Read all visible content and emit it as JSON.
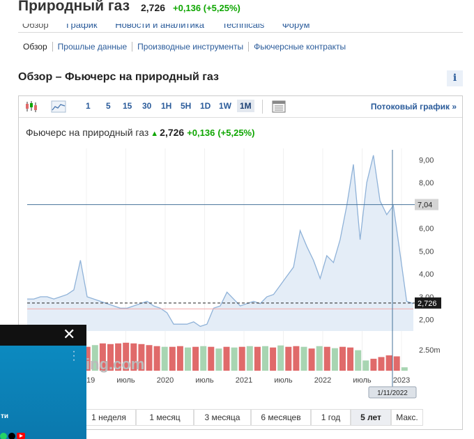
{
  "header": {
    "title": "Природный газ",
    "price": "2,726",
    "change": "+0,136 (+5,25%)"
  },
  "top_tabs": [
    "Обзор",
    "График",
    "Новости и аналитика",
    "Technicals",
    "Форум"
  ],
  "subnav": [
    "Обзор",
    "Прошлые данные",
    "Производные инструменты",
    "Фьючерсные контракты"
  ],
  "section_title": "Обзор – Фьючерс на природный газ",
  "info_icon_label": "i",
  "toolbar": {
    "periods": [
      "1",
      "5",
      "15",
      "30",
      "1H",
      "5H",
      "1D",
      "1W",
      "1M"
    ],
    "active_period": "1M",
    "stream_link": "Потоковый график »"
  },
  "chart_header": {
    "name": "Фьючерс на природный газ",
    "price": "2,726",
    "change": "+0,136",
    "change_pct": "(+5,25%)"
  },
  "watermark": "ing.com",
  "range_buttons": [
    "1 неделя",
    "1 месяц",
    "3 месяца",
    "6 месяцев",
    "1 год",
    "5 лет",
    "Макс."
  ],
  "active_range": "5 лет",
  "video_overlay": {
    "close_label": "✕",
    "caption_fragment": "ти"
  },
  "colors": {
    "positive": "#0ea600",
    "link": "#2a5b9a",
    "area_fill": "#e4edf7",
    "line": "#8fb2d8",
    "volume_up": "#a8d5b2",
    "volume_down": "#e06a6a"
  },
  "chart_data": {
    "type": "area",
    "title": "Фьючерс на природный газ",
    "x_ticks": [
      "2019",
      "июль",
      "2020",
      "июль",
      "2021",
      "июль",
      "2022",
      "июль",
      "2023"
    ],
    "y_ticks": [
      "2,00",
      "3,00",
      "4,00",
      "5,00",
      "6,00",
      "7,00",
      "8,00",
      "9,00"
    ],
    "ylim": [
      1.5,
      9.5
    ],
    "crosshair_value": "7,04",
    "crosshair_date": "1/11/2022",
    "last_value": "2,726",
    "volume_label": "2.50m",
    "series": [
      {
        "values": [
          2.9,
          2.9,
          3.0,
          3.0,
          2.9,
          3.0,
          3.1,
          3.3,
          4.6,
          3.0,
          2.9,
          2.8,
          2.7,
          2.6,
          2.5,
          2.5,
          2.6,
          2.7,
          2.8,
          2.6,
          2.5,
          2.3,
          1.8,
          1.8,
          1.8,
          1.9,
          1.7,
          1.8,
          2.5,
          2.6,
          3.2,
          2.9,
          2.6,
          2.7,
          2.8,
          2.7,
          3.0,
          3.1,
          3.5,
          3.9,
          4.3,
          5.9,
          5.2,
          4.6,
          3.8,
          4.8,
          4.5,
          5.5,
          7.0,
          8.8,
          5.5,
          8.0,
          9.2,
          7.2,
          6.6,
          7.0,
          4.9,
          2.8,
          2.7
        ]
      }
    ],
    "volume": [
      {
        "v": 0.3,
        "up": true
      },
      {
        "v": 0.35,
        "up": false
      },
      {
        "v": 0.4,
        "up": true
      },
      {
        "v": 0.45,
        "up": false
      },
      {
        "v": 0.5,
        "up": true
      },
      {
        "v": 0.55,
        "up": false
      },
      {
        "v": 0.6,
        "up": true
      },
      {
        "v": 0.7,
        "up": false
      },
      {
        "v": 0.75,
        "up": true
      },
      {
        "v": 0.8,
        "up": false
      },
      {
        "v": 0.78,
        "up": false
      },
      {
        "v": 0.8,
        "up": false
      },
      {
        "v": 0.82,
        "up": false
      },
      {
        "v": 0.8,
        "up": false
      },
      {
        "v": 0.78,
        "up": false
      },
      {
        "v": 0.75,
        "up": false
      },
      {
        "v": 0.72,
        "up": false
      },
      {
        "v": 0.7,
        "up": true
      },
      {
        "v": 0.7,
        "up": false
      },
      {
        "v": 0.72,
        "up": false
      },
      {
        "v": 0.68,
        "up": true
      },
      {
        "v": 0.7,
        "up": false
      },
      {
        "v": 0.72,
        "up": true
      },
      {
        "v": 0.7,
        "up": false
      },
      {
        "v": 0.65,
        "up": true
      },
      {
        "v": 0.7,
        "up": false
      },
      {
        "v": 0.68,
        "up": true
      },
      {
        "v": 0.7,
        "up": false
      },
      {
        "v": 0.72,
        "up": true
      },
      {
        "v": 0.7,
        "up": false
      },
      {
        "v": 0.72,
        "up": true
      },
      {
        "v": 0.68,
        "up": false
      },
      {
        "v": 0.74,
        "up": true
      },
      {
        "v": 0.7,
        "up": false
      },
      {
        "v": 0.72,
        "up": false
      },
      {
        "v": 0.7,
        "up": true
      },
      {
        "v": 0.65,
        "up": false
      },
      {
        "v": 0.72,
        "up": true
      },
      {
        "v": 0.7,
        "up": false
      },
      {
        "v": 0.66,
        "up": true
      },
      {
        "v": 0.7,
        "up": false
      },
      {
        "v": 0.68,
        "up": false
      },
      {
        "v": 0.6,
        "up": true
      },
      {
        "v": 0.3,
        "up": true
      },
      {
        "v": 0.35,
        "up": false
      },
      {
        "v": 0.4,
        "up": false
      },
      {
        "v": 0.45,
        "up": false
      },
      {
        "v": 0.42,
        "up": false
      },
      {
        "v": 0.1,
        "up": true
      }
    ]
  }
}
